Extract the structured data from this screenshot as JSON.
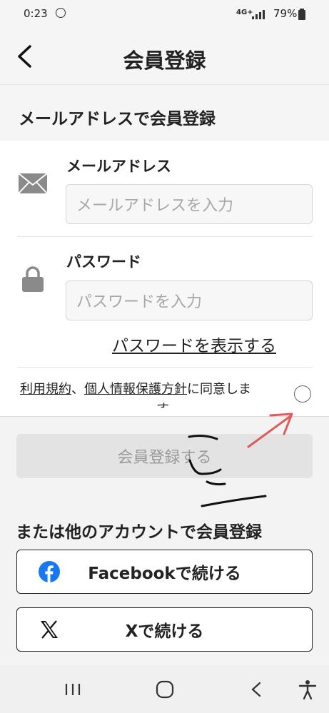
{
  "status_bar": {
    "time": "0:23",
    "network": "4G+",
    "battery": "79%"
  },
  "header": {
    "title": "会員登録"
  },
  "section": {
    "title": "メールアドレスで会員登録"
  },
  "email": {
    "label": "メールアドレス",
    "placeholder": "メールアドレスを入力"
  },
  "password": {
    "label": "パスワード",
    "placeholder": "パスワードを入力",
    "show_label": "パスワードを表示する"
  },
  "consent": {
    "terms_link": "利用規約",
    "separator": "、",
    "privacy_link": "個人情報保護方針",
    "text_line1": "に同意しま",
    "text_line2": "す。"
  },
  "submit": {
    "label": "会員登録する"
  },
  "alternative": {
    "heading": "または他のアカウントで会員登録",
    "facebook_label": "Facebookで続ける",
    "x_label": "Xで続ける"
  },
  "colors": {
    "facebook": "#1877f2",
    "annotation": "#e05a5a"
  }
}
